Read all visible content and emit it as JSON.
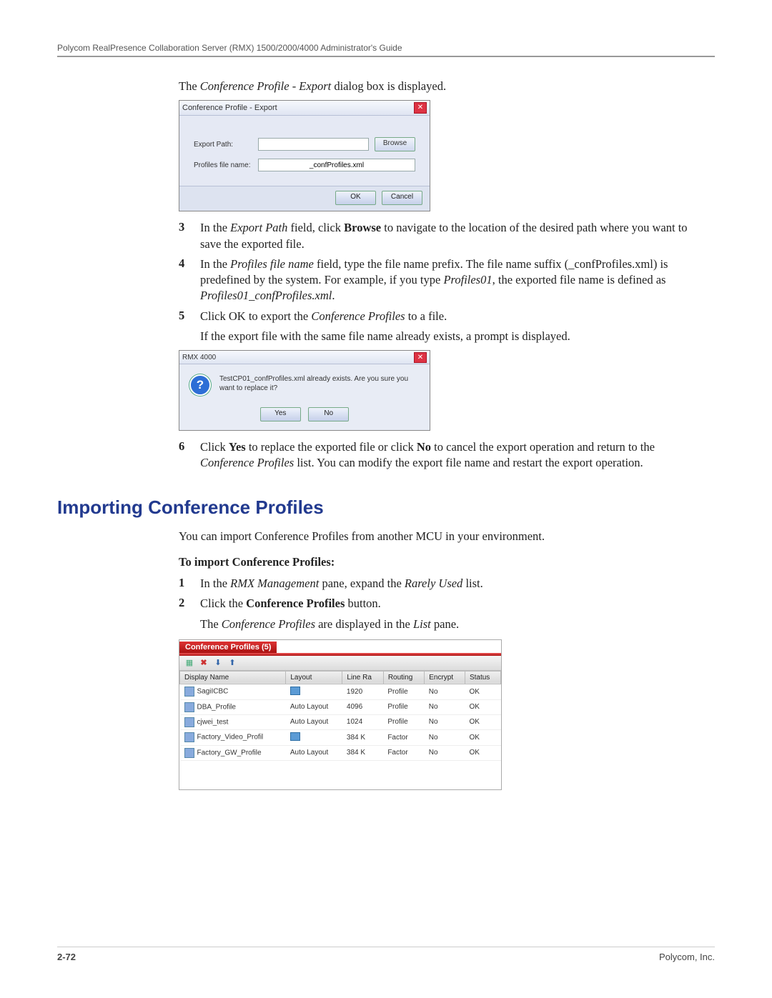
{
  "header": {
    "title": "Polycom RealPresence Collaboration Server (RMX) 1500/2000/4000 Administrator's Guide"
  },
  "intro_line": {
    "pre": "The ",
    "italic": "Conference Profile - Export",
    "post": " dialog box is displayed."
  },
  "dlg1": {
    "title": "Conference Profile - Export",
    "export_path_label": "Export Path:",
    "export_path_value": "",
    "browse_label": "Browse",
    "profiles_file_label": "Profiles file name:",
    "profiles_file_value": "_confProfiles.xml",
    "ok_label": "OK",
    "cancel_label": "Cancel"
  },
  "steps_a": [
    {
      "num": "3",
      "parts": [
        {
          "t": "In the "
        },
        {
          "t": "Export Path",
          "i": true
        },
        {
          "t": " field, click "
        },
        {
          "t": "Browse",
          "b": true
        },
        {
          "t": " to navigate to the location of the desired path where you want to save the exported file."
        }
      ]
    },
    {
      "num": "4",
      "parts": [
        {
          "t": "In the "
        },
        {
          "t": "Profiles file name",
          "i": true
        },
        {
          "t": " field, type the file name prefix. The file name suffix (_confProfiles.xml) is predefined by the system. For example, if you type "
        },
        {
          "t": "Profiles01",
          "i": true
        },
        {
          "t": ", the exported file name is defined as "
        },
        {
          "t": "Profiles01_confProfiles.xml",
          "i": true
        },
        {
          "t": "."
        }
      ]
    },
    {
      "num": "5",
      "parts": [
        {
          "t": "Click OK to export the "
        },
        {
          "t": "Conference Profiles",
          "i": true
        },
        {
          "t": " to a file."
        }
      ],
      "sub": "If the export file with the same file name already exists, a prompt is displayed."
    }
  ],
  "dlg2": {
    "title": "RMX 4000",
    "message": "TestCP01_confProfiles.xml already exists. Are you sure you want to replace it?",
    "yes_label": "Yes",
    "no_label": "No"
  },
  "step6": {
    "num": "6",
    "parts": [
      {
        "t": "Click "
      },
      {
        "t": "Yes",
        "b": true
      },
      {
        "t": " to replace the exported file or click "
      },
      {
        "t": "No",
        "b": true
      },
      {
        "t": " to cancel the export operation and return to the "
      },
      {
        "t": "Conference Profiles",
        "i": true
      },
      {
        "t": " list. You can modify the export file name and restart the export operation."
      }
    ]
  },
  "section_heading": "Importing Conference Profiles",
  "import_intro": "You can import Conference Profiles from another MCU in your environment.",
  "import_to_label": "To import Conference Profiles:",
  "steps_b": [
    {
      "num": "1",
      "parts": [
        {
          "t": "In the "
        },
        {
          "t": "RMX Management",
          "i": true
        },
        {
          "t": " pane, expand the "
        },
        {
          "t": "Rarely Used",
          "i": true
        },
        {
          "t": " list."
        }
      ]
    },
    {
      "num": "2",
      "parts": [
        {
          "t": "Click the "
        },
        {
          "t": "Conference Profiles",
          "b": true
        },
        {
          "t": " button."
        }
      ],
      "sub_parts": [
        {
          "t": "The "
        },
        {
          "t": "Conference Profiles",
          "i": true
        },
        {
          "t": " are displayed in the "
        },
        {
          "t": "List",
          "i": true
        },
        {
          "t": " pane."
        }
      ]
    }
  ],
  "listpane": {
    "tab_title": "Conference Profiles (5)",
    "columns": [
      "Display Name",
      "Layout",
      "Line Ra",
      "Routing",
      "Encrypt",
      "Status"
    ],
    "rows": [
      {
        "name": "SagiICBC",
        "layout": "icon",
        "rate": "1920",
        "routing": "Profile",
        "encrypt": "No",
        "status": "OK"
      },
      {
        "name": "DBA_Profile",
        "layout": "Auto Layout",
        "rate": "4096",
        "routing": "Profile",
        "encrypt": "No",
        "status": "OK"
      },
      {
        "name": "cjwei_test",
        "layout": "Auto Layout",
        "rate": "1024",
        "routing": "Profile",
        "encrypt": "No",
        "status": "OK"
      },
      {
        "name": "Factory_Video_Profil",
        "layout": "icon",
        "rate": "384 K",
        "routing": "Factor",
        "encrypt": "No",
        "status": "OK"
      },
      {
        "name": "Factory_GW_Profile",
        "layout": "Auto Layout",
        "rate": "384 K",
        "routing": "Factor",
        "encrypt": "No",
        "status": "OK"
      }
    ]
  },
  "footer": {
    "page_num": "2-72",
    "company": "Polycom, Inc."
  }
}
